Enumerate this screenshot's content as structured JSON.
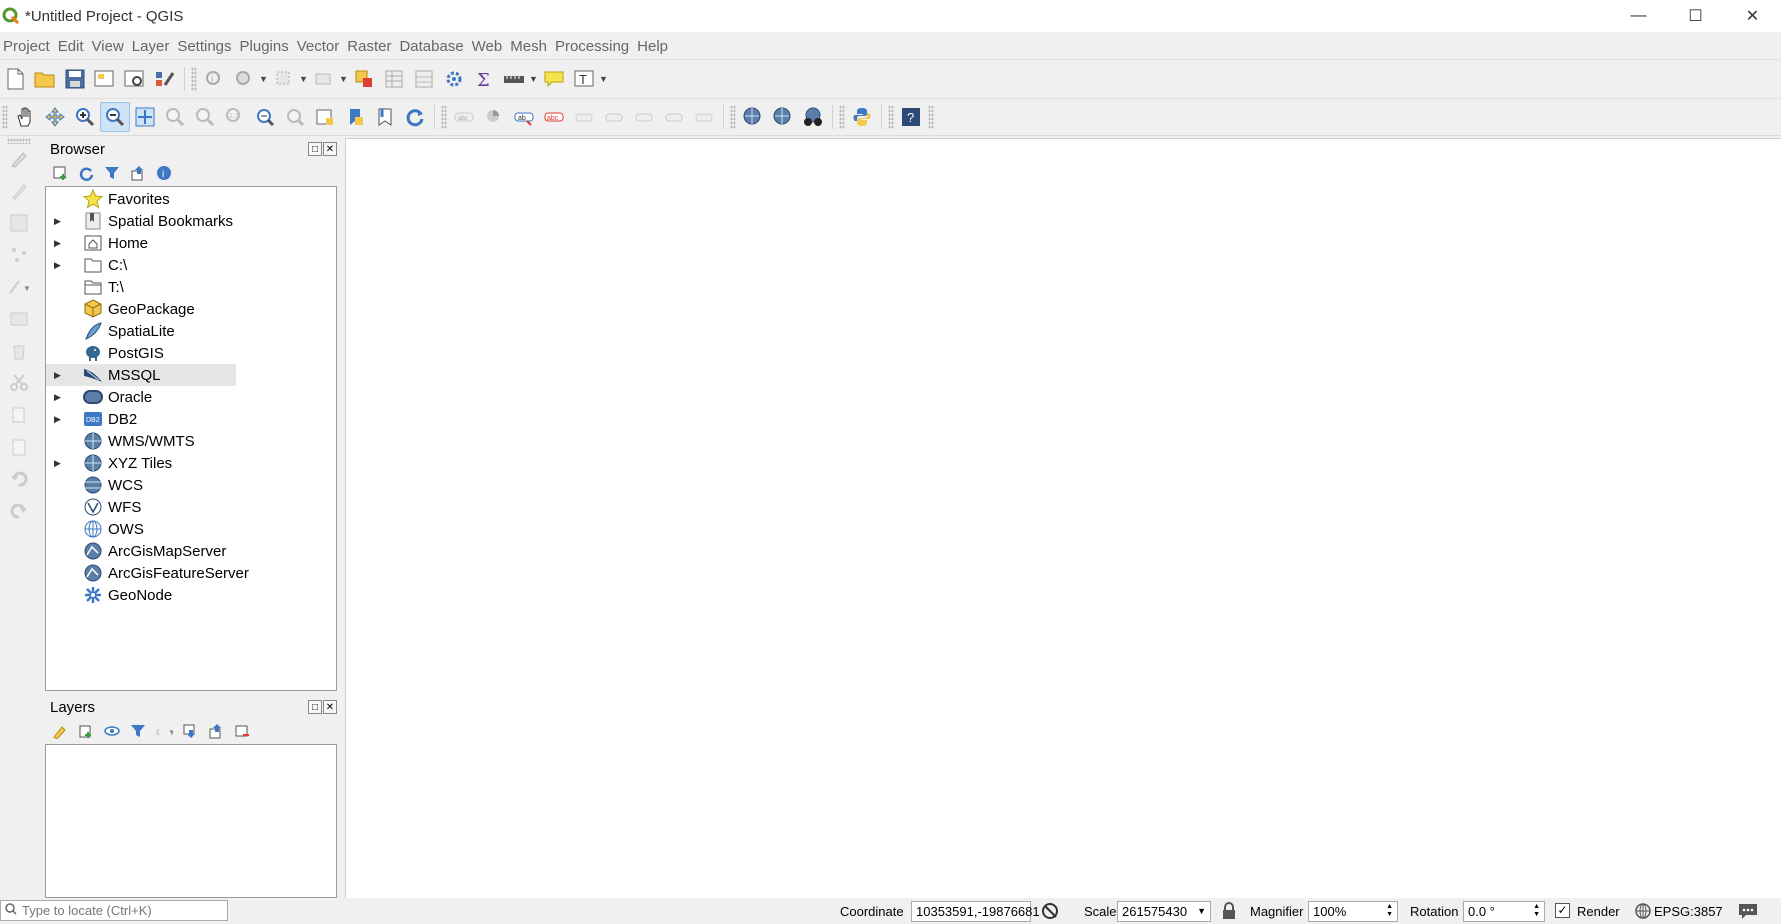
{
  "window": {
    "title": "*Untitled Project - QGIS"
  },
  "menu": {
    "items": [
      "Project",
      "Edit",
      "View",
      "Layer",
      "Settings",
      "Plugins",
      "Vector",
      "Raster",
      "Database",
      "Web",
      "Mesh",
      "Processing",
      "Help"
    ]
  },
  "browser": {
    "title": "Browser",
    "items": [
      {
        "label": "Favorites",
        "icon": "star-icon",
        "expandable": false
      },
      {
        "label": "Spatial Bookmarks",
        "icon": "bookmark-icon",
        "expandable": true
      },
      {
        "label": "Home",
        "icon": "home-folder-icon",
        "expandable": true
      },
      {
        "label": "C:\\",
        "icon": "folder-icon",
        "expandable": true
      },
      {
        "label": "T:\\",
        "icon": "drive-folder-icon",
        "expandable": false
      },
      {
        "label": "GeoPackage",
        "icon": "geopackage-icon",
        "expandable": false
      },
      {
        "label": "SpatiaLite",
        "icon": "spatialite-feather-icon",
        "expandable": false
      },
      {
        "label": "PostGIS",
        "icon": "postgis-elephant-icon",
        "expandable": false
      },
      {
        "label": "MSSQL",
        "icon": "mssql-icon",
        "expandable": true
      },
      {
        "label": "Oracle",
        "icon": "oracle-icon",
        "expandable": true
      },
      {
        "label": "DB2",
        "icon": "db2-icon",
        "expandable": true
      },
      {
        "label": "WMS/WMTS",
        "icon": "wms-globe-icon",
        "expandable": false
      },
      {
        "label": "XYZ Tiles",
        "icon": "xyz-globe-icon",
        "expandable": true
      },
      {
        "label": "WCS",
        "icon": "wcs-globe-icon",
        "expandable": false
      },
      {
        "label": "WFS",
        "icon": "wfs-globe-icon",
        "expandable": false
      },
      {
        "label": "OWS",
        "icon": "ows-globe-icon",
        "expandable": false
      },
      {
        "label": "ArcGisMapServer",
        "icon": "arcgis-map-icon",
        "expandable": false
      },
      {
        "label": "ArcGisFeatureServer",
        "icon": "arcgis-feature-icon",
        "expandable": false
      },
      {
        "label": "GeoNode",
        "icon": "geonode-icon",
        "expandable": false
      }
    ],
    "selected_index": 8
  },
  "layers": {
    "title": "Layers"
  },
  "status": {
    "locator_placeholder": "Type to locate (Ctrl+K)",
    "coordinate_label": "Coordinate",
    "coordinate_value": "10353591,-19876681",
    "scale_label": "Scale",
    "scale_value": "261575430",
    "magnifier_label": "Magnifier",
    "magnifier_value": "100%",
    "rotation_label": "Rotation",
    "rotation_value": "0.0 °",
    "render_label": "Render",
    "crs_label": "EPSG:3857"
  },
  "colors": {
    "accent": "#3c78c3",
    "map_background": "#ffffff",
    "chrome": "#f0f0f0"
  }
}
